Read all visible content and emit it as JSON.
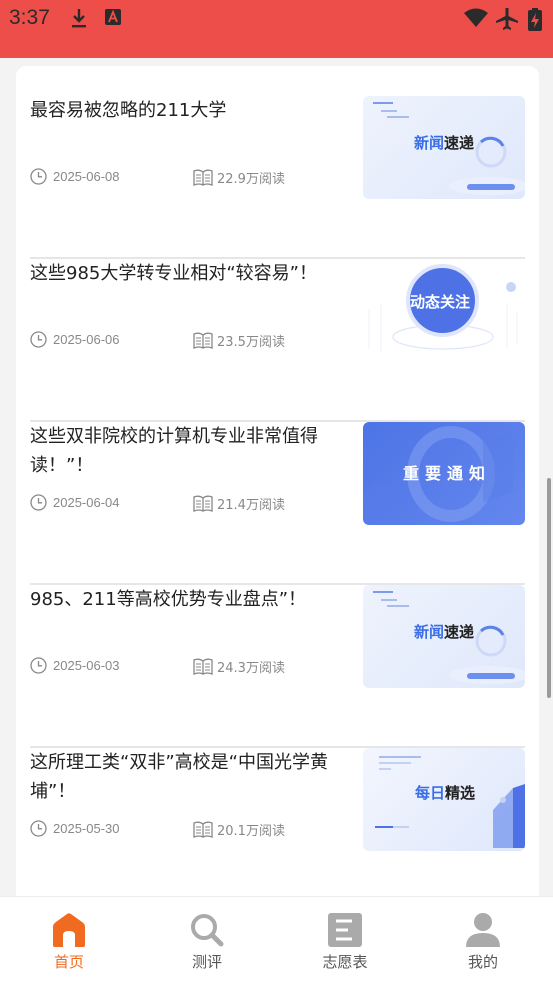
{
  "status_bar": {
    "time": "3:37"
  },
  "articles": [
    {
      "title": "最容易被忽略的211大学",
      "date": "2025-06-08",
      "reads": "22.9万阅读",
      "thumb": "news"
    },
    {
      "title": "这些985大学转专业相对“较容易”！",
      "date": "2025-06-06",
      "reads": "23.5万阅读",
      "thumb": "dynamic"
    },
    {
      "title": "这些双非院校的计算机专业非常值得读！”！",
      "date": "2025-06-04",
      "reads": "21.4万阅读",
      "thumb": "notice"
    },
    {
      "title": "985、211等高校优势专业盘点”！",
      "date": "2025-06-03",
      "reads": "24.3万阅读",
      "thumb": "news"
    },
    {
      "title": "这所理工类“双非”高校是“中国光学黄埔”！",
      "date": "2025-05-30",
      "reads": "20.1万阅读",
      "thumb": "daily"
    }
  ],
  "thumbs": {
    "news_a": "新闻",
    "news_b": "速递",
    "dynamic": "动态关注",
    "notice": "重要通知",
    "daily_a": "每日",
    "daily_b": "精选"
  },
  "tabs": [
    {
      "label": "首页",
      "icon": "home-icon",
      "active": true
    },
    {
      "label": "测评",
      "icon": "search-icon",
      "active": false
    },
    {
      "label": "志愿表",
      "icon": "form-icon",
      "active": false
    },
    {
      "label": "我的",
      "icon": "user-icon",
      "active": false
    }
  ],
  "colors": {
    "status_bar": "#ee4e4a",
    "accent": "#f06a1f",
    "brand_blue": "#4e72e6"
  }
}
